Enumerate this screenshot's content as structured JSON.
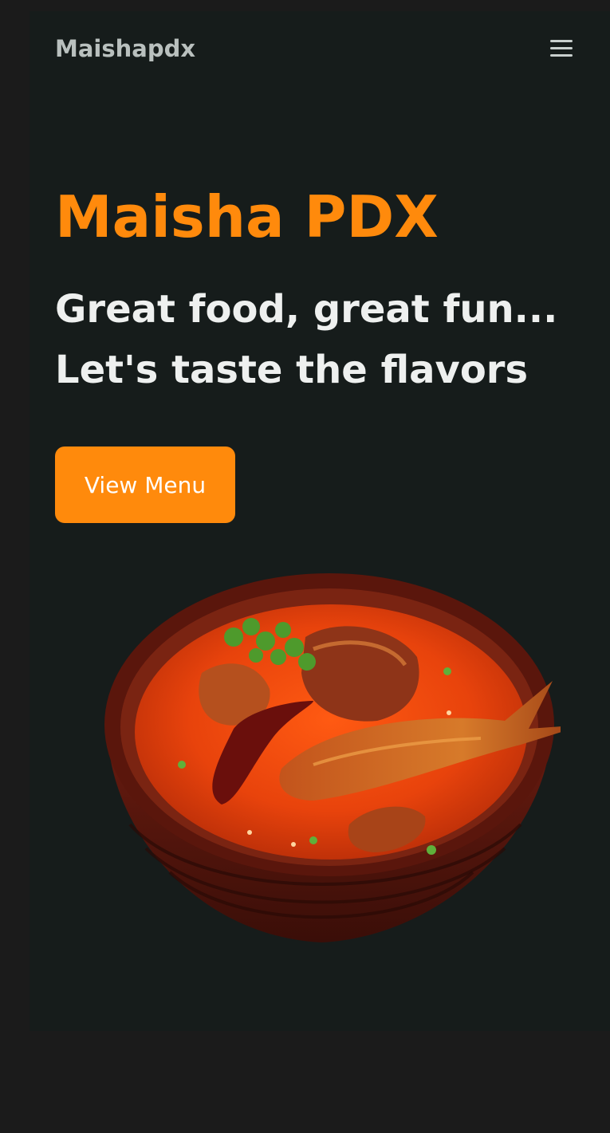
{
  "navbar": {
    "brand": "Maishapdx",
    "menu_icon": "hamburger-menu-icon"
  },
  "hero": {
    "title": "Maisha PDX",
    "tagline_line1": "Great food, great fun...",
    "tagline_line2": "Let's taste the flavors",
    "cta_label": "View Menu",
    "image_alt": "Fish curry in a clay bowl"
  },
  "colors": {
    "accent": "#ff8a0c",
    "background": "#161c1b",
    "outer_background": "#1b1b1b",
    "heading_text": "#eef0ef",
    "brand_text": "#b9c0be"
  }
}
